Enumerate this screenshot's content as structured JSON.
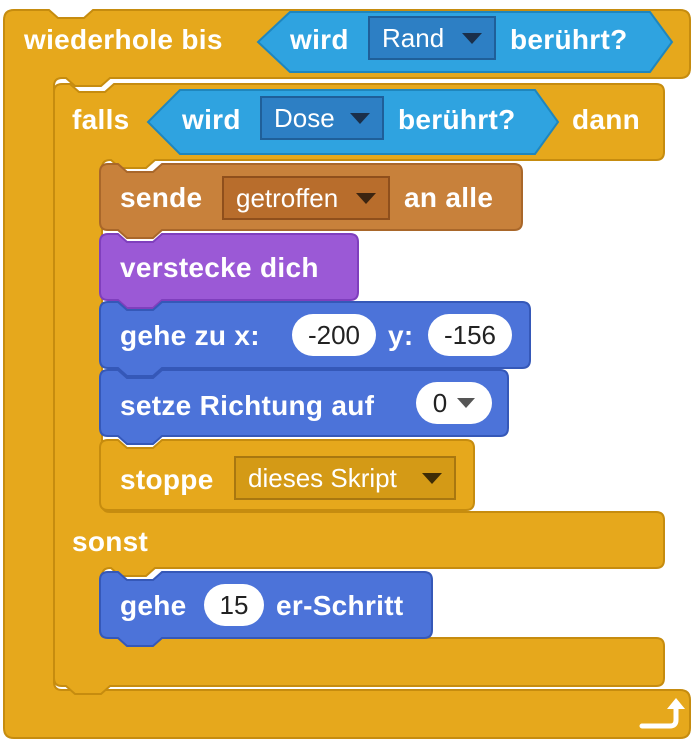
{
  "loop": {
    "label": "wiederhole bis",
    "condition": {
      "prefix": "wird",
      "target": "Rand",
      "suffix": "berührt?"
    },
    "icon": "loop-arrow-icon"
  },
  "if_block": {
    "label": "falls",
    "condition": {
      "prefix": "wird",
      "target": "Dose",
      "suffix": "berührt?"
    },
    "then_label": "dann",
    "else_label": "sonst"
  },
  "broadcast": {
    "label": "sende",
    "message": "getroffen",
    "suffix": "an alle"
  },
  "hide": {
    "label": "verstecke dich"
  },
  "goto": {
    "label": "gehe zu x:",
    "x_value": "-200",
    "y_label": "y:",
    "y_value": "-156"
  },
  "direction": {
    "label": "setze Richtung auf",
    "value": "0"
  },
  "stop": {
    "label": "stoppe",
    "option": "dieses Skript"
  },
  "move": {
    "label": "gehe",
    "steps": "15",
    "suffix": "er-Schritt"
  },
  "colors": {
    "control": "#e6a81c",
    "events": "#c8813b",
    "looks": "#9b59d6",
    "motion": "#4c73d9",
    "sensing": "#2fa3e0"
  }
}
